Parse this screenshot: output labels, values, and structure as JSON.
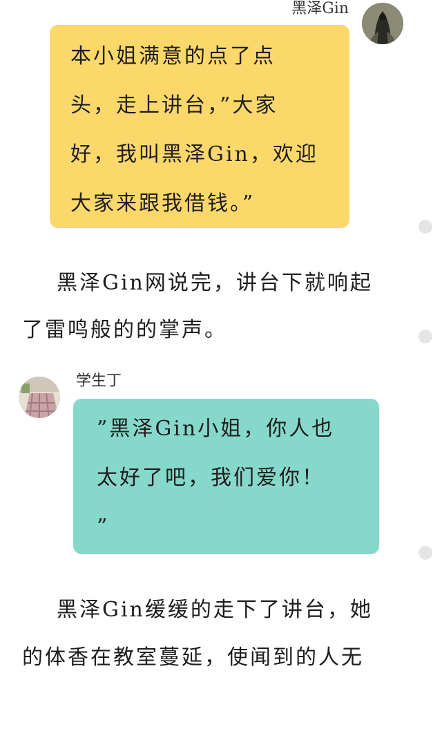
{
  "messages": [
    {
      "sender": "黑泽Gin",
      "color": "#fcd86a",
      "lines": [
        "本小姐满意的点了点",
        "头，走上讲台，”大家",
        "好，我叫黑泽Gin，欢迎",
        "大家来跟我借钱。”"
      ]
    },
    {
      "sender": "学生丁",
      "color": "#86d8ca",
      "lines": [
        "”黑泽Gin小姐，你人也",
        "太好了吧，我们爱你！",
        "”"
      ]
    }
  ],
  "narration": [
    [
      "黑泽Gin网说完，讲台下就响起",
      "了雷鸣般的的掌声。"
    ],
    [
      "黑泽Gin缓缓的走下了讲台，她",
      "的体香在教室蔓延，使闻到的人无"
    ]
  ],
  "icons": {
    "avatar_1": "dark-hooded-figure-avatar",
    "avatar_2": "plaid-skirt-avatar",
    "side_dot": "reading-progress-dot"
  }
}
